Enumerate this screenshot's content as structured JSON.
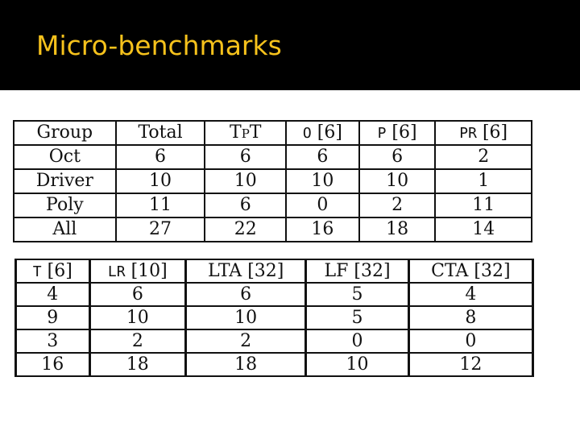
{
  "slide": {
    "title": "Micro-benchmarks",
    "title_color": "#f6c21c",
    "background_color": "#000000"
  },
  "table_top": {
    "headers": [
      {
        "name": "Group",
        "ref": ""
      },
      {
        "name": "Total",
        "ref": ""
      },
      {
        "name": "TpT",
        "ref": ""
      },
      {
        "name": "O",
        "ref": "[6]"
      },
      {
        "name": "P",
        "ref": "[6]"
      },
      {
        "name": "PR",
        "ref": "[6]"
      }
    ],
    "rows": [
      {
        "group": "Oct",
        "values": [
          "6",
          "6",
          "6",
          "6",
          "2"
        ]
      },
      {
        "group": "Driver",
        "values": [
          "10",
          "10",
          "10",
          "10",
          "1"
        ]
      },
      {
        "group": "Poly",
        "values": [
          "11",
          "6",
          "0",
          "2",
          "11"
        ]
      },
      {
        "group": "All",
        "values": [
          "27",
          "22",
          "16",
          "18",
          "14"
        ]
      }
    ]
  },
  "table_bottom": {
    "headers": [
      {
        "name": "T",
        "ref": "[6]"
      },
      {
        "name": "LR",
        "ref": "[10]"
      },
      {
        "name": "LTA",
        "ref": "[32]"
      },
      {
        "name": "LF",
        "ref": "[32]"
      },
      {
        "name": "CTA",
        "ref": "[32]"
      }
    ],
    "rows": [
      [
        "4",
        "6",
        "6",
        "5",
        "4"
      ],
      [
        "9",
        "10",
        "10",
        "5",
        "8"
      ],
      [
        "3",
        "2",
        "2",
        "0",
        "0"
      ],
      [
        "16",
        "18",
        "18",
        "10",
        "12"
      ]
    ]
  }
}
